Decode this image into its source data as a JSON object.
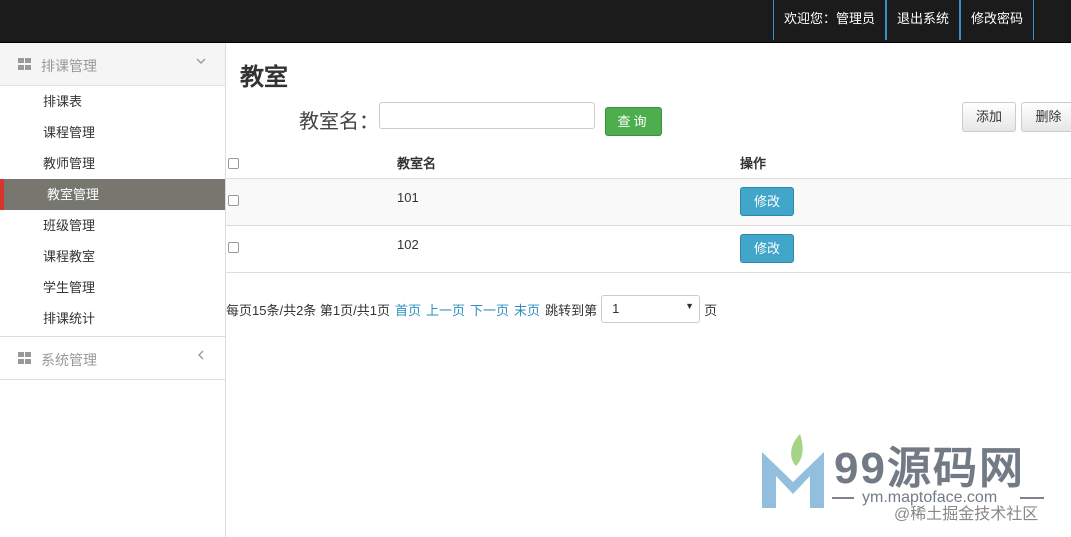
{
  "topbar": {
    "welcome": "欢迎您：管理员",
    "logout": "退出系统",
    "change_password": "修改密码"
  },
  "sidebar": {
    "group1": {
      "title": "排课管理",
      "items": [
        "排课表",
        "课程管理",
        "教师管理",
        "教室管理",
        "班级管理",
        "课程教室",
        "学生管理",
        "排课统计"
      ],
      "active_index": 3
    },
    "group2": {
      "title": "系统管理"
    }
  },
  "main": {
    "title": "教室",
    "search": {
      "label": "教室名：",
      "value": "",
      "button": "查询"
    },
    "actions": {
      "add": "添加",
      "delete": "删除"
    },
    "table": {
      "headers": [
        "教室名",
        "操作"
      ],
      "rows": [
        {
          "name": "101",
          "action": "修改"
        },
        {
          "name": "102",
          "action": "修改"
        }
      ]
    },
    "pager": {
      "summary": "每页15条/共2条 第1页/共1页",
      "first": "首页",
      "prev": "上一页",
      "next": "下一页",
      "last": "末页",
      "jump_label": "跳转到第",
      "selected_page": "1",
      "suffix": "页"
    }
  },
  "watermark": {
    "brand": "99源码网",
    "url": "ym.maptoface.com",
    "juejin": "@稀土掘金技术社区"
  },
  "colors": {
    "topbar_bg": "#1b1b1b",
    "active_menu_bg": "#777770",
    "active_marker": "#d9342b",
    "query_button": "#4cae4c",
    "edit_button": "#41a6c9",
    "link": "#2a8fbd"
  }
}
